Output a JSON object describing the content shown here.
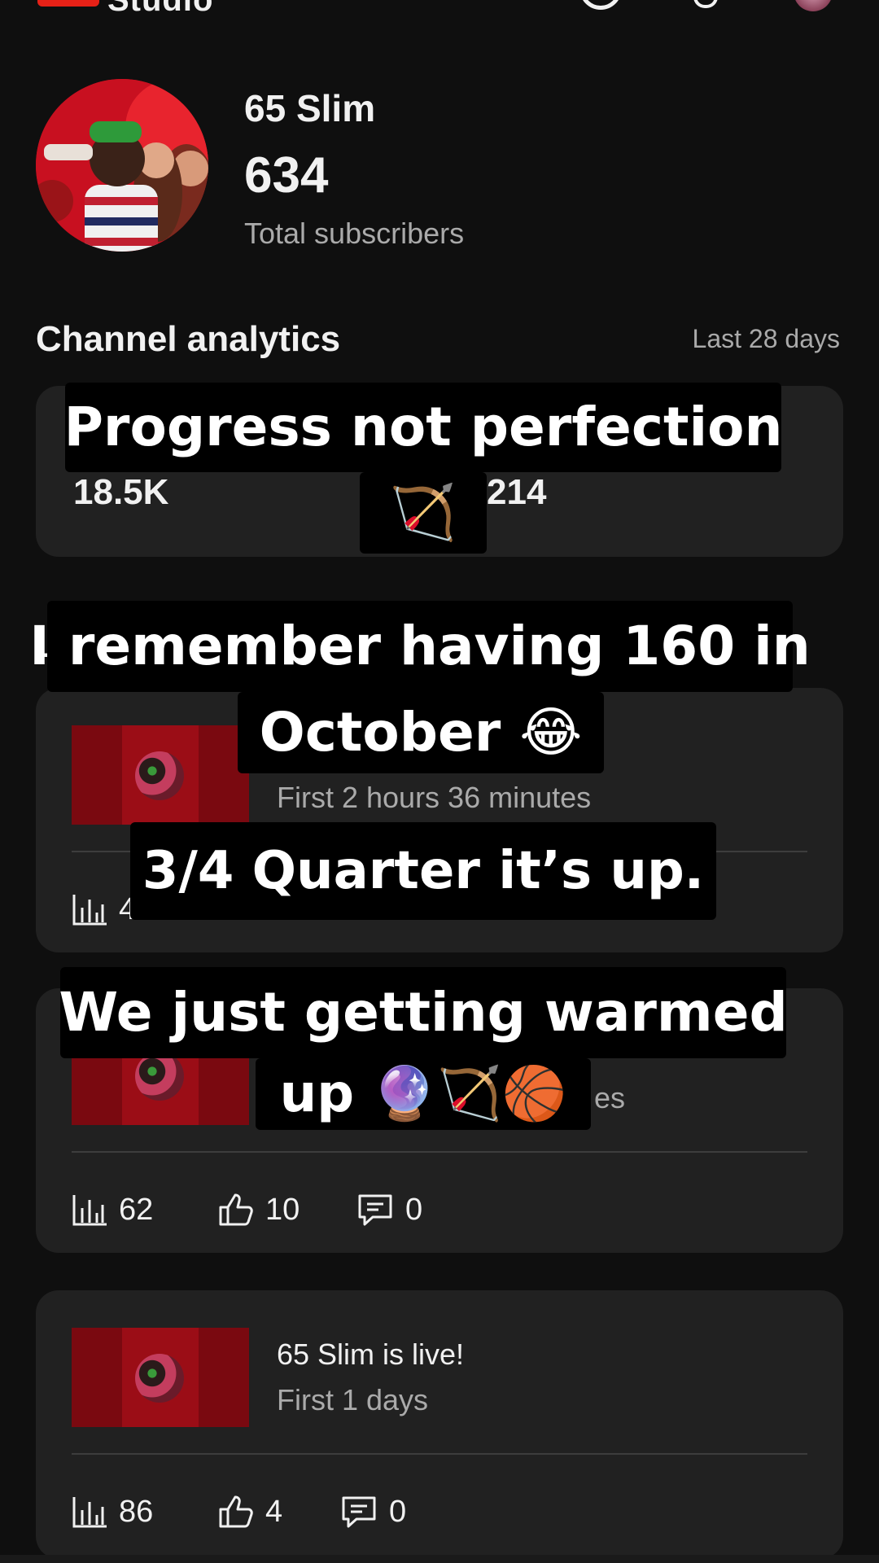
{
  "app": {
    "logo_text": "Studio"
  },
  "channel": {
    "name": "65 Slim",
    "subscriber_count": "634",
    "subscriber_label": "Total subscribers"
  },
  "analytics": {
    "title": "Channel analytics",
    "range": "Last 28 days",
    "stats": [
      "18.5K",
      "214"
    ]
  },
  "section_partial_letter": "L",
  "videos": [
    {
      "title": "",
      "subtitle": "First 2 hours 36 minutes",
      "views": "4",
      "likes": "",
      "comments": ""
    },
    {
      "title": "",
      "subtitle": "es",
      "views": "62",
      "likes": "10",
      "comments": "0"
    },
    {
      "title": "65 Slim is live!",
      "subtitle": "First 1 days",
      "views": "86",
      "likes": "4",
      "comments": "0"
    }
  ],
  "captions": {
    "c1": "Progress not perfection",
    "c1_emoji": "🏹",
    "c2_line1": "I remember having 160 in",
    "c2_line2": "October 😂",
    "c3": "3/4 Quarter it’s up.",
    "c4_line1": "We just getting warmed",
    "c4_line2": "up 🔮🏹🏀"
  },
  "colors": {
    "background": "#0f0f0f",
    "card": "#212121",
    "accent_red": "#e62117",
    "secondary_text": "#aaaaaa"
  },
  "icons": {
    "views": "bar-chart-icon",
    "likes": "thumbs-up-icon",
    "comments": "comment-icon"
  }
}
